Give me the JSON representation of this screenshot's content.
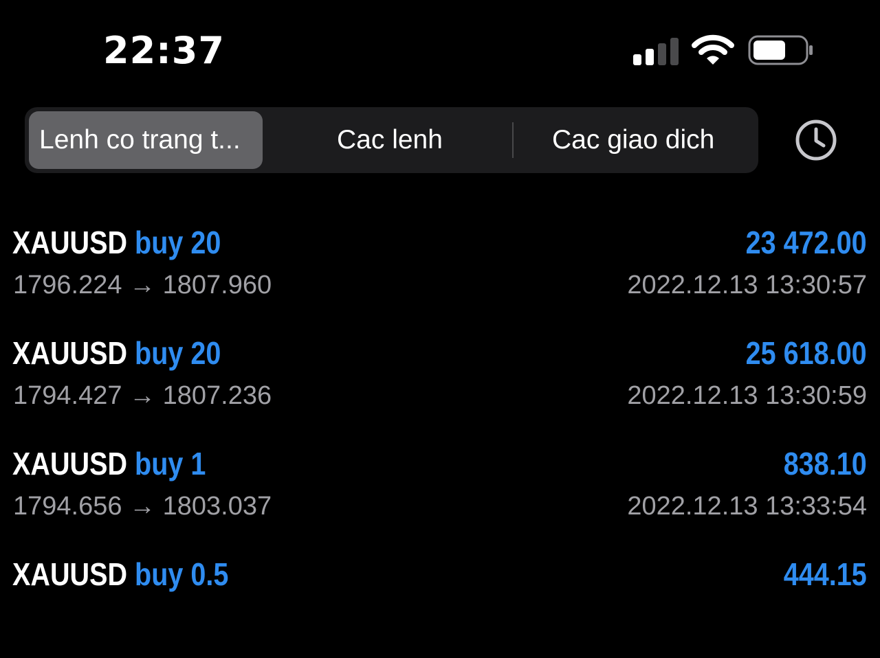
{
  "status_bar": {
    "time": "22:37"
  },
  "tabs": [
    {
      "label": "Lenh co trang t...",
      "active": true
    },
    {
      "label": "Cac lenh",
      "active": false
    },
    {
      "label": "Cac giao dich",
      "active": false
    }
  ],
  "colors": {
    "accent": "#2f8cf0",
    "background": "#000000",
    "secondary_text": "#a1a1a6",
    "segment_bg": "#1c1c1e",
    "segment_active": "#636366"
  },
  "icons": {
    "history": "clock-icon",
    "signal": "cellular-signal-icon",
    "wifi": "wifi-icon",
    "battery": "battery-icon"
  },
  "trades": [
    {
      "symbol": "XAUUSD",
      "direction": "buy 20",
      "prices": "1796.224 → 1807.960",
      "profit": "23 472.00",
      "time": "2022.12.13 13:30:57"
    },
    {
      "symbol": "XAUUSD",
      "direction": "buy 20",
      "prices": "1794.427 → 1807.236",
      "profit": "25 618.00",
      "time": "2022.12.13 13:30:59"
    },
    {
      "symbol": "XAUUSD",
      "direction": "buy 1",
      "prices": "1794.656 → 1803.037",
      "profit": "838.10",
      "time": "2022.12.13 13:33:54"
    },
    {
      "symbol": "XAUUSD",
      "direction": "buy 0.5",
      "prices": "",
      "profit": "444.15",
      "time": ""
    }
  ]
}
